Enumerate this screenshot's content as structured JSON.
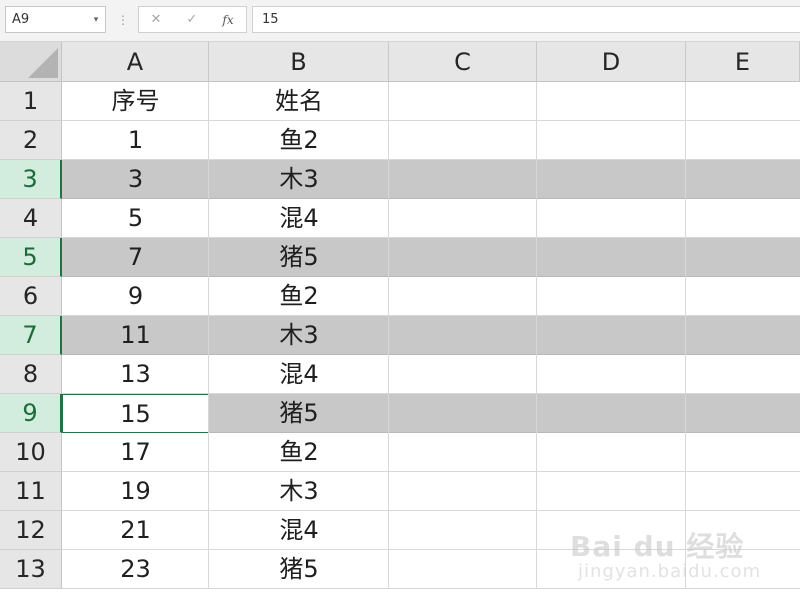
{
  "name_box": {
    "value": "A9"
  },
  "formula_bar": {
    "cancel_icon": "x-icon",
    "enter_icon": "check-icon",
    "function_icon": "fx-icon",
    "function_label": "fx",
    "value": "15"
  },
  "columns": [
    "A",
    "B",
    "C",
    "D",
    "E"
  ],
  "rows": [
    {
      "num": "1",
      "a": "序号",
      "b": "姓名"
    },
    {
      "num": "2",
      "a": "1",
      "b": "鱼2"
    },
    {
      "num": "3",
      "a": "3",
      "b": "木3"
    },
    {
      "num": "4",
      "a": "5",
      "b": "混4"
    },
    {
      "num": "5",
      "a": "7",
      "b": "猪5"
    },
    {
      "num": "6",
      "a": "9",
      "b": "鱼2"
    },
    {
      "num": "7",
      "a": "11",
      "b": "木3"
    },
    {
      "num": "8",
      "a": "13",
      "b": "混4"
    },
    {
      "num": "9",
      "a": "15",
      "b": "猪5"
    },
    {
      "num": "10",
      "a": "17",
      "b": "鱼2"
    },
    {
      "num": "11",
      "a": "19",
      "b": "木3"
    },
    {
      "num": "12",
      "a": "21",
      "b": "混4"
    },
    {
      "num": "13",
      "a": "23",
      "b": "猪5"
    }
  ],
  "watermark": {
    "main": "Bai du 经验",
    "sub": "jingyan.baidu.com"
  },
  "colors": {
    "selection_green": "#217346",
    "shaded_row": "#c8c8c8",
    "header_bg": "#e6e6e6"
  }
}
